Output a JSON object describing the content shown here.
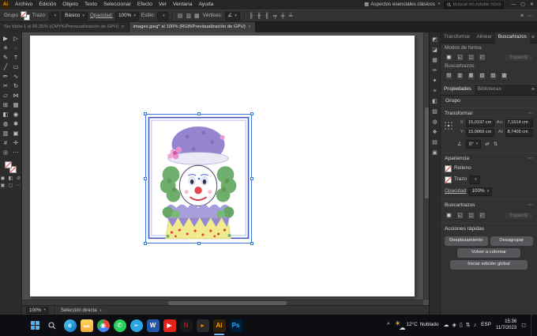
{
  "icons": {
    "workspace": "▦",
    "panel_menu": "≡",
    "more_options": "⋯",
    "angle": "∠",
    "flip_h": "⇄",
    "flip_v": "⇅",
    "minimize": "—",
    "maximize": "▢",
    "close": "✕",
    "tab_close": "✕",
    "sun": "☀",
    "cloud": "☁",
    "notification": "◻"
  },
  "menubar": {
    "logo": "Ai",
    "items": [
      "Archivo",
      "Edición",
      "Objeto",
      "Texto",
      "Seleccionar",
      "Efecto",
      "Ver",
      "Ventana",
      "Ayuda"
    ],
    "workspace": "Aspectos esenciales clásicos",
    "search_placeholder": "Buscar en Adobe Stock"
  },
  "controlbar": {
    "context": "Grupo",
    "stroke_label": "Trazo:",
    "brush": "Básico",
    "opacity_label": "Opacidad:",
    "opacity_value": "100%",
    "style_label": "Estilo:",
    "vertices_label": "Vértices:",
    "doc_icons": [
      {
        "name": "document-setup-icon",
        "glyph": "▤"
      },
      {
        "name": "preferences-icon",
        "glyph": "▥"
      },
      {
        "name": "isolate-selection-icon",
        "glyph": "▦"
      }
    ],
    "align_icons": [
      {
        "name": "align-left-icon",
        "glyph": "╟"
      },
      {
        "name": "align-center-icon",
        "glyph": "╫"
      },
      {
        "name": "align-right-icon",
        "glyph": "╢"
      },
      {
        "name": "align-top-icon",
        "glyph": "╤"
      },
      {
        "name": "align-middle-icon",
        "glyph": "╪"
      },
      {
        "name": "align-bottom-icon",
        "glyph": "╧"
      }
    ]
  },
  "doc_tabs": [
    {
      "label": "Sin título-1 al 66.35% (CMYK/Previsualización de GPU)"
    },
    {
      "label": "images.jpeg* al 100% (RGB/Previsualización de GPU)"
    }
  ],
  "toolbar": {
    "tools": [
      {
        "name": "selection-tool",
        "glyph": "▶"
      },
      {
        "name": "direct-selection-tool",
        "glyph": "▷"
      },
      {
        "name": "magic-wand-tool",
        "glyph": "✳"
      },
      {
        "name": "lasso-tool",
        "glyph": "◌"
      },
      {
        "name": "pen-tool",
        "glyph": "✎"
      },
      {
        "name": "type-tool",
        "glyph": "T"
      },
      {
        "name": "line-segment-tool",
        "glyph": "╱"
      },
      {
        "name": "rectangle-tool",
        "glyph": "▭"
      },
      {
        "name": "paintbrush-tool",
        "glyph": "✏"
      },
      {
        "name": "shaper-tool",
        "glyph": "∿"
      },
      {
        "name": "scissors-tool",
        "glyph": "✂"
      },
      {
        "name": "rotate-tool",
        "glyph": "↻"
      },
      {
        "name": "scale-tool",
        "glyph": "▱"
      },
      {
        "name": "width-tool",
        "glyph": "⋈"
      },
      {
        "name": "free-transform-tool",
        "glyph": "⊞"
      },
      {
        "name": "mesh-tool",
        "glyph": "▦"
      },
      {
        "name": "gradient-tool",
        "glyph": "◧"
      },
      {
        "name": "eyedropper-tool",
        "glyph": "◉"
      },
      {
        "name": "blend-tool",
        "glyph": "◍"
      },
      {
        "name": "symbol-sprayer-tool",
        "glyph": "✱"
      },
      {
        "name": "column-graph-tool",
        "glyph": "▥"
      },
      {
        "name": "artboard-tool",
        "glyph": "▣"
      },
      {
        "name": "slice-tool",
        "glyph": "#"
      },
      {
        "name": "hand-tool",
        "glyph": "✛"
      },
      {
        "name": "zoom-tool",
        "glyph": "◎"
      },
      {
        "name": "edit-toolbar-icon",
        "glyph": "⋯"
      }
    ],
    "footer_icons": [
      {
        "name": "fill-color-icon",
        "glyph": "◼"
      },
      {
        "name": "gradient-icon",
        "glyph": "◧"
      },
      {
        "name": "none-icon",
        "glyph": "⊘"
      },
      {
        "name": "draw-mode-icon",
        "glyph": "▣"
      },
      {
        "name": "screen-mode-icon",
        "glyph": "▢"
      },
      {
        "name": "toolbar-more-icon",
        "glyph": "⋯"
      }
    ]
  },
  "panel_strip": [
    {
      "name": "color-panel-icon",
      "glyph": "◩"
    },
    {
      "name": "color-guide-icon",
      "glyph": "◪"
    },
    {
      "name": "swatches-icon",
      "glyph": "▦"
    },
    {
      "name": "brushes-icon",
      "glyph": "✏"
    },
    {
      "name": "symbols-icon",
      "glyph": "✦"
    },
    {
      "name": "stroke-panel-icon",
      "glyph": "≡"
    },
    {
      "name": "gradient-panel-icon",
      "glyph": "◧"
    },
    {
      "name": "transparency-icon",
      "glyph": "▨"
    },
    {
      "name": "appearance-icon",
      "glyph": "◍"
    },
    {
      "name": "graphic-styles-icon",
      "glyph": "❖"
    },
    {
      "name": "layers-icon",
      "glyph": "▤"
    },
    {
      "name": "artboards-icon",
      "glyph": "▣"
    }
  ],
  "pathfinder_panel": {
    "tabs": [
      "Transformar",
      "Alinear",
      "Buscartrazos"
    ],
    "shape_modes_label": "Modos de forma:",
    "shape_mode_icons": [
      {
        "name": "unite-icon",
        "glyph": "◼"
      },
      {
        "name": "minus-front-icon",
        "glyph": "◱"
      },
      {
        "name": "intersect-icon",
        "glyph": "◫"
      },
      {
        "name": "exclude-icon",
        "glyph": "◰"
      }
    ],
    "expand_button": "Expandir",
    "pathfinder_label": "Buscartrazos:",
    "pathfinder_icons": [
      {
        "name": "divide-icon",
        "glyph": "▤"
      },
      {
        "name": "trim-icon",
        "glyph": "▥"
      },
      {
        "name": "merge-icon",
        "glyph": "▦"
      },
      {
        "name": "crop-icon",
        "glyph": "▧"
      },
      {
        "name": "outline-icon",
        "glyph": "▨"
      },
      {
        "name": "minus-back-icon",
        "glyph": "▩"
      }
    ]
  },
  "properties_panel": {
    "tabs": [
      "Propiedades",
      "Bibliotecas"
    ],
    "selection_type": "Grupo",
    "transform": {
      "title": "Transformar",
      "x_label": "X:",
      "x_value": "15,0197 cm",
      "y_label": "Y:",
      "y_value": "15,0069 cm",
      "w_label": "An:",
      "w_value": "7,1614 cm",
      "h_label": "Al:",
      "h_value": "8,7409 cm",
      "rotation": "0°"
    },
    "appearance": {
      "title": "Apariencia",
      "fill_label": "Relleno",
      "stroke_label": "Trazo",
      "opacity_label": "Opacidad",
      "opacity_value": "100%"
    },
    "pathfinder": {
      "title": "Buscartrazos",
      "expand_button": "Expandir",
      "icons": [
        {
          "name": "unite-icon",
          "glyph": "◼"
        },
        {
          "name": "minus-front-icon",
          "glyph": "◱"
        },
        {
          "name": "intersect-icon",
          "glyph": "◫"
        },
        {
          "name": "exclude-icon",
          "glyph": "◰"
        }
      ]
    },
    "quick_actions": {
      "title": "Acciones rápidas",
      "buttons": [
        "Desplazamiento",
        "Desagrupar",
        "Volver a colorear",
        "Iniciar edición global"
      ]
    }
  },
  "statusbar": {
    "zoom": "100%",
    "tool": "Selección directa"
  },
  "taskbar": {
    "hidden_icons_chevron": "^",
    "apps": [
      {
        "name": "edge-icon",
        "glyph": "e",
        "bg": "linear-gradient(135deg,#49c9f2,#1472be)",
        "fg": "#ffffff",
        "radius": "50%"
      },
      {
        "name": "file-explorer-icon",
        "glyph": "▬",
        "bg": "linear-gradient(180deg,#ffd65c,#f2a93b)",
        "fg": "#fff3d0",
        "radius": "3px"
      },
      {
        "name": "chrome-icon",
        "glyph": "◉",
        "bg": "conic-gradient(#ea4335 0deg 120deg,#4285f4 120deg 240deg,#34a853 240deg 360deg)",
        "fg": "#ffffff",
        "radius": "50%"
      },
      {
        "name": "whatsapp-icon",
        "glyph": "✆",
        "bg": "#2ad05e",
        "fg": "#ffffff",
        "radius": "50%"
      },
      {
        "name": "telegram-icon",
        "glyph": "➢",
        "bg": "#2ca5e0",
        "fg": "#ffffff",
        "radius": "50%"
      },
      {
        "name": "word-icon",
        "glyph": "W",
        "bg": "#2156a8",
        "fg": "#ffffff",
        "radius": "3px"
      },
      {
        "name": "youtube-icon",
        "glyph": "▶",
        "bg": "#e62117",
        "fg": "#ffffff",
        "radius": "3px"
      },
      {
        "name": "netflix-icon",
        "glyph": "N",
        "bg": "#191919",
        "fg": "#e50914",
        "radius": "3px"
      },
      {
        "name": "media-player-icon",
        "glyph": "▸",
        "bg": "#2b2b2b",
        "fg": "#ff8800",
        "radius": "3px"
      },
      {
        "name": "illustrator-icon",
        "glyph": "Ai",
        "bg": "#31230b",
        "fg": "#ff9a00",
        "radius": "3px",
        "indicator": "#76b9ed"
      },
      {
        "name": "photoshop-icon",
        "glyph": "Ps",
        "bg": "#001e36",
        "fg": "#31a8ff",
        "radius": "3px"
      }
    ],
    "weather": {
      "temp": "12°C",
      "condition": "Nublado"
    },
    "tray_icons": [
      {
        "name": "onedrive-icon",
        "glyph": "☁"
      },
      {
        "name": "security-icon",
        "glyph": "◈"
      },
      {
        "name": "battery-icon",
        "glyph": "▯"
      },
      {
        "name": "network-icon",
        "glyph": "⇅"
      },
      {
        "name": "volume-icon",
        "glyph": "♪"
      }
    ],
    "language": "ESP",
    "time": "15:36",
    "date": "11/7/2023"
  },
  "artwork": {
    "palette": {
      "frame": "#4656c4",
      "hat": "#9585cf",
      "flower": "#ec8fcd",
      "hair": "#6fae6d",
      "face": "#ffffff",
      "nose": "#e8474b",
      "collar": "#a79ede",
      "body": "#f0ec8e",
      "dots": "#e2403f"
    },
    "selection_color": "#3a7bdc"
  }
}
